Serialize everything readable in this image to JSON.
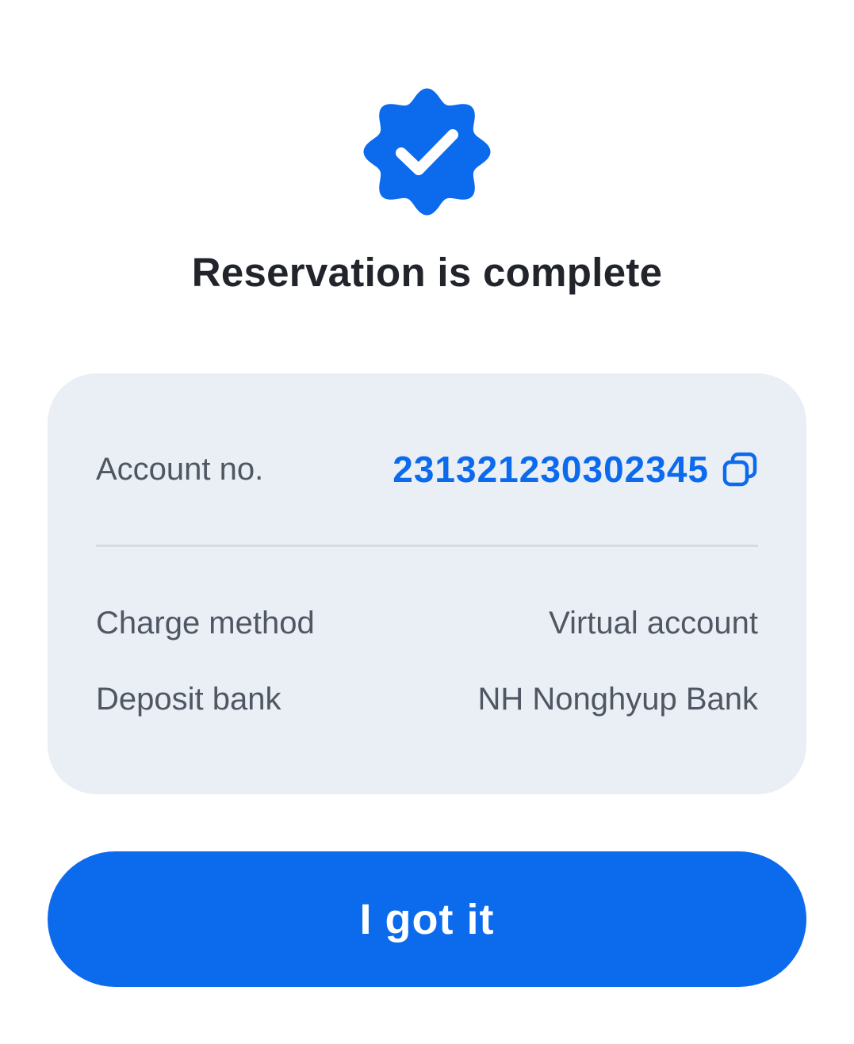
{
  "status": {
    "icon": "verified-badge-check-icon",
    "title": "Reservation is complete"
  },
  "details": {
    "account": {
      "label": "Account no.",
      "value": "231321230302345",
      "copy_icon": "copy-icon"
    },
    "rows": [
      {
        "label": "Charge method",
        "value": "Virtual account"
      },
      {
        "label": "Deposit bank",
        "value": "NH Nonghyup Bank"
      }
    ]
  },
  "actions": {
    "confirm_label": "I got it"
  },
  "colors": {
    "accent": "#0c6aed",
    "card_background": "#eaeef5",
    "title_text": "#21252b",
    "secondary_text": "#4f5763",
    "divider": "#d6dae2"
  }
}
